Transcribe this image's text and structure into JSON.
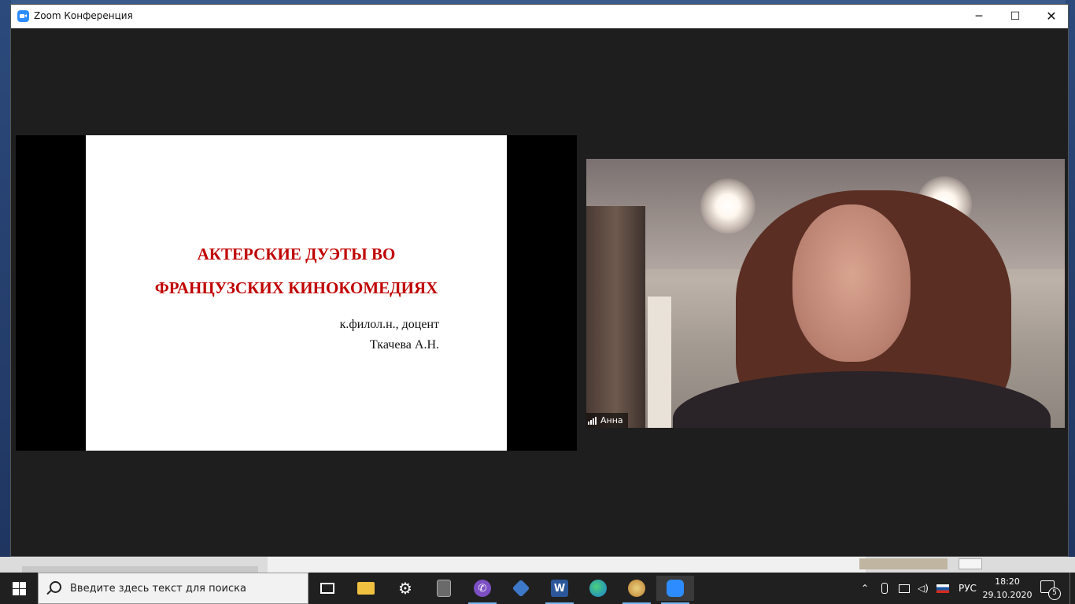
{
  "window": {
    "title": "Zoom Конференция",
    "minimize": "─",
    "maximize": "☐",
    "close": "✕"
  },
  "slide": {
    "title_line1": "АКТЕРСКИЕ ДУЭТЫ ВО",
    "title_line2": "ФРАНЦУЗСКИХ КИНОКОМЕДИЯХ",
    "author_line1": "к.филол.н., доцент",
    "author_line2": "Ткачева А.Н.",
    "title_color": "#c00000"
  },
  "participant": {
    "name": "Анна"
  },
  "taskbar": {
    "search_placeholder": "Введите здесь текст для поиска",
    "apps": [
      {
        "name": "task-view-icon"
      },
      {
        "name": "file-explorer-icon"
      },
      {
        "name": "settings-icon"
      },
      {
        "name": "calculator-icon"
      },
      {
        "name": "viber-icon"
      },
      {
        "name": "snipping-tool-icon"
      },
      {
        "name": "word-icon",
        "glyph": "W"
      },
      {
        "name": "edge-icon"
      },
      {
        "name": "paint-icon"
      },
      {
        "name": "zoom-icon"
      }
    ],
    "language": "РУС",
    "time": "18:20",
    "date": "29.10.2020",
    "notification_count": "5"
  }
}
